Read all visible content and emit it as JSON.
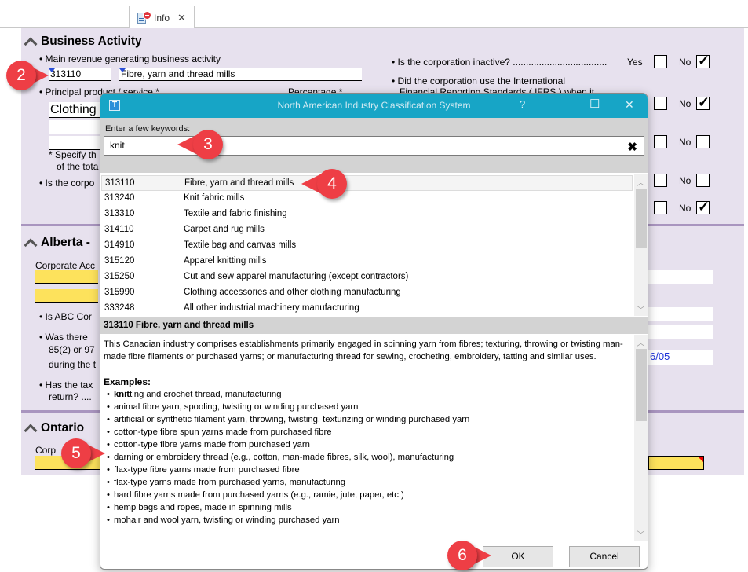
{
  "tab": {
    "label": "Info",
    "icon": "document-error-icon",
    "close": "✕"
  },
  "business_activity": {
    "title": "Business Activity",
    "main_revenue_label": "• Main revenue generating business activity",
    "naics_code": "313110",
    "naics_description": "Fibre, yarn and thread mills",
    "principal_product_label": "• Principal product / service *",
    "percentage_label": "Percentage *",
    "product_value": "Clothing",
    "specify_note_1": "* Specify th",
    "specify_note_2": "of the tota",
    "is_corp_label": "• Is the corpo",
    "inactive_question": "• Is the corporation inactive? ....................................",
    "ifrs_question_1": "• Did the corporation use the International",
    "ifrs_question_2": "Financial Reporting Standards ( IFRS ) when it",
    "yes": "Yes",
    "no": "No",
    "checkboxes": [
      {
        "yes": false,
        "no": true
      },
      {
        "yes": false,
        "no": true
      },
      {
        "yes": false,
        "no": false
      },
      {
        "yes": false,
        "no": false
      },
      {
        "yes": false,
        "no": true
      }
    ]
  },
  "alberta": {
    "title": "Alberta - ",
    "corporate_acc_label": "Corporate Acc",
    "q1": "• Is ABC Cor",
    "q2_1": "• Was there",
    "q2_2": "85(2) or 97",
    "q2_3": "during the t",
    "q3_1": "• Has the tax",
    "q3_2": "return?  ....",
    "date_partial": "6/05"
  },
  "ontario": {
    "title": "Ontario",
    "corp_label": "Corp"
  },
  "dialog": {
    "title": "North American Industry Classification System",
    "help": "?",
    "minimize": "—",
    "maximize": "☐",
    "close": "✕",
    "search_label": "Enter a few keywords:",
    "search_value": "knit",
    "clear": "✖",
    "results": [
      {
        "code": "313110",
        "description": "Fibre, yarn and thread mills",
        "selected": true
      },
      {
        "code": "313240",
        "description": "Knit fabric mills"
      },
      {
        "code": "313310",
        "description": "Textile and fabric finishing"
      },
      {
        "code": "314110",
        "description": "Carpet and rug mills"
      },
      {
        "code": "314910",
        "description": "Textile bag and canvas mills"
      },
      {
        "code": "315120",
        "description": "Apparel knitting mills"
      },
      {
        "code": "315250",
        "description": "Cut and sew apparel manufacturing (except contractors)"
      },
      {
        "code": "315990",
        "description": "Clothing accessories and other clothing manufacturing"
      },
      {
        "code": "333248",
        "description": "All other industrial machinery manufacturing"
      }
    ],
    "detail_title": "313110 Fibre, yarn and thread mills",
    "detail_text": "This Canadian industry comprises establishments primarily engaged in spinning yarn from fibres; texturing, throwing or twisting man-made fibre filaments or purchased yarns; or manufacturing thread for sewing, crocheting, embroidery, tatting and similar uses.",
    "examples_label": "Examples:",
    "examples_first_bold": "knit",
    "examples_first_rest": "ting and crochet thread, manufacturing",
    "examples": [
      "animal fibre yarn, spooling, twisting or winding purchased yarn",
      "artificial or synthetic filament yarn, throwing, twisting, texturizing or winding purchased yarn",
      "cotton-type fibre spun yarns made from purchased fibre",
      "cotton-type fibre yarns made from purchased yarn",
      "darning or embroidery thread (e.g., cotton, man-made fibres, silk, wool), manufacturing",
      "flax-type fibre yarns made from purchased fibre",
      "flax-type yarns made from purchased yarns, manufacturing",
      "hard fibre yarns made from purchased yarns (e.g., ramie, jute, paper, etc.)",
      "hemp bags and ropes, made in spinning mills",
      "mohair and wool yarn, twisting or winding purchased yarn"
    ],
    "ok": "OK",
    "cancel": "Cancel"
  },
  "callouts": [
    "2",
    "3",
    "4",
    "5",
    "6"
  ],
  "colors": {
    "accent": "#17a5c6",
    "callout": "#ee3e45",
    "form_bg": "#e7e1ee",
    "required_field": "#fde25c"
  }
}
